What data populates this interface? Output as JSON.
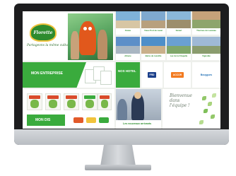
{
  "hero": {
    "brand": "Florette",
    "tagline": "Partageons la même culture !"
  },
  "cities": [
    {
      "name": "Ouzeu",
      "color_a": "#7fb2d8",
      "color_b": "#d7c6a4"
    },
    {
      "name": "Vieux Port de Laval",
      "color_a": "#7fa9cf",
      "color_b": "#b8a07e"
    },
    {
      "name": "Sénart",
      "color_a": "#8ab7d9",
      "color_b": "#9c8e6c"
    },
    {
      "name": "Thermes de Lacanau",
      "color_a": "#c5a27a",
      "color_b": "#8ea56c"
    },
    {
      "name": "Athene",
      "color_a": "#5d8fc8",
      "color_b": "#a9b6c2"
    },
    {
      "name": "Bains de Lanville",
      "color_a": "#4d8fc9",
      "color_b": "#c9b08a"
    },
    {
      "name": "Lac de la Chapelle",
      "color_a": "#6aa0d2",
      "color_b": "#7fa66a"
    },
    {
      "name": "Vignoble",
      "color_a": "#9fb9d6",
      "color_b": "#8a9c6e"
    }
  ],
  "partner": {
    "label": "MON ENTREPRISE"
  },
  "mini": {
    "label": "NOS HOTEL"
  },
  "logos": [
    {
      "text": "FRD",
      "bg": "#1b3f8a",
      "fg": "#ffffff"
    },
    {
      "text": "ACCOR",
      "bg": "#f37a1f",
      "fg": "#ffffff"
    },
    {
      "text": "Bouygues",
      "bg": "#ffffff",
      "fg": "#1f6fb5"
    }
  ],
  "products": {
    "label": "MON DIS"
  },
  "news": {
    "label": "Les nouveaux arrivants"
  },
  "welcome": {
    "text": "Bienvenue dans l'équipe !"
  }
}
